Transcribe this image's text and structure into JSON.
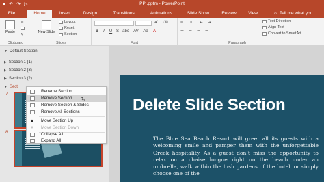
{
  "window": {
    "title": "PPI.pptm - PowerPoint"
  },
  "quick_access": {
    "save_icon": "save-icon",
    "undo_icon": "undo-icon",
    "redo_icon": "redo-icon",
    "present_icon": "present-icon"
  },
  "tabs": [
    "File",
    "Home",
    "Insert",
    "Design",
    "Transitions",
    "Animations",
    "Slide Show",
    "Review",
    "View"
  ],
  "active_tab": "Home",
  "tell_me": "Tell me what you",
  "ribbon": {
    "clipboard": {
      "paste": "Paste",
      "label": "Clipboard"
    },
    "slides": {
      "new_slide": "New Slide",
      "layout": "Layout",
      "reset": "Reset",
      "section": "Section",
      "label": "Slides"
    },
    "font": {
      "label": "Font",
      "buttons": [
        "B",
        "I",
        "U",
        "S",
        "abc",
        "AV",
        "Aa",
        "A"
      ]
    },
    "paragraph": {
      "label": "Paragraph",
      "text_direction": "Text Direction",
      "align_text": "Align Text",
      "convert_smartart": "Convert to SmartArt"
    }
  },
  "sections": {
    "default": "Default Section",
    "items": [
      "Section 1 (1)",
      "Section 2 (3)",
      "Section 3 (2)"
    ],
    "selected": "Secti"
  },
  "slide_numbers": [
    "7",
    "8"
  ],
  "context_menu": {
    "items": [
      {
        "label": "Rename Section",
        "state": "normal"
      },
      {
        "label": "Remove Section",
        "state": "highlighted"
      },
      {
        "label": "Remove Section & Slides",
        "state": "normal"
      },
      {
        "label": "Remove All Sections",
        "state": "normal"
      },
      {
        "label": "Move Section Up",
        "state": "normal"
      },
      {
        "label": "Move Section Down",
        "state": "disabled"
      },
      {
        "label": "Collapse All",
        "state": "normal"
      },
      {
        "label": "Expand All",
        "state": "normal"
      }
    ]
  },
  "slide": {
    "title": "Delete Slide Section",
    "body": "The Blue Sea Beach Resort will greet all its guests with a welcoming smile and pamper them with the unforgettable Greek hospitality. As a guest don’t miss the opportunity to relax on a chaise longue right on the beach under an umbrella, walk within the lush gardens of the hotel, or simply choose one of the"
  },
  "colors": {
    "accent": "#b7472a",
    "slide_bg": "#1c5168",
    "highlight": "#d3d3d3"
  }
}
